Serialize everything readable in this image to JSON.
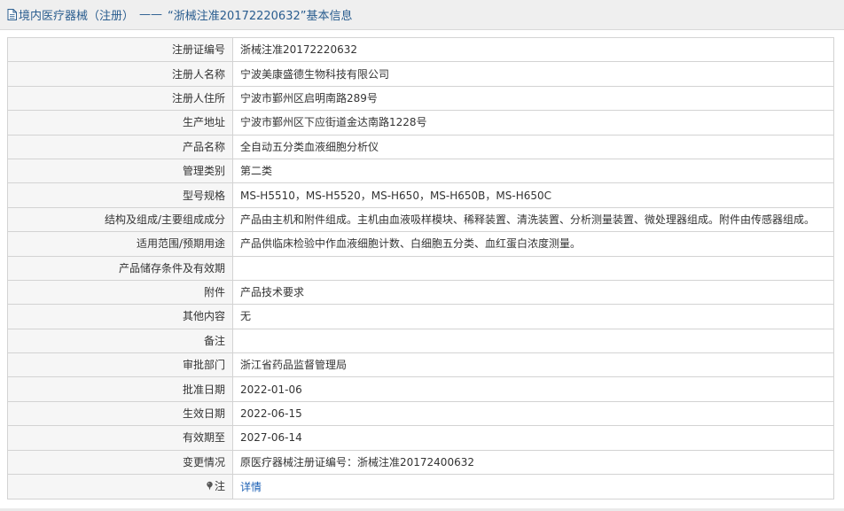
{
  "header": {
    "category": "境内医疗器械（注册）",
    "separator": "——",
    "reg_quote": "“浙械注准20172220632”",
    "suffix": "基本信息"
  },
  "rows": [
    {
      "label": "注册证编号",
      "value": "浙械注准20172220632"
    },
    {
      "label": "注册人名称",
      "value": "宁波美康盛德生物科技有限公司"
    },
    {
      "label": "注册人住所",
      "value": "宁波市鄞州区启明南路289号"
    },
    {
      "label": "生产地址",
      "value": "宁波市鄞州区下应街道金达南路1228号"
    },
    {
      "label": "产品名称",
      "value": "全自动五分类血液细胞分析仪"
    },
    {
      "label": "管理类别",
      "value": "第二类"
    },
    {
      "label": "型号规格",
      "value": "MS-H5510，MS-H5520，MS-H650，MS-H650B，MS-H650C"
    },
    {
      "label": "结构及组成/主要组成成分",
      "value": "产品由主机和附件组成。主机由血液吸样模块、稀释装置、清洗装置、分析测量装置、微处理器组成。附件由传感器组成。"
    },
    {
      "label": "适用范围/预期用途",
      "value": "产品供临床检验中作血液细胞计数、白细胞五分类、血红蛋白浓度测量。"
    },
    {
      "label": "产品储存条件及有效期",
      "value": ""
    },
    {
      "label": "附件",
      "value": "产品技术要求"
    },
    {
      "label": "其他内容",
      "value": "无"
    },
    {
      "label": "备注",
      "value": ""
    },
    {
      "label": "审批部门",
      "value": "浙江省药品监督管理局"
    },
    {
      "label": "批准日期",
      "value": "2022-01-06"
    },
    {
      "label": "生效日期",
      "value": "2022-06-15"
    },
    {
      "label": "有效期至",
      "value": "2027-06-14"
    },
    {
      "label": "变更情况",
      "value": "原医疗器械注册证编号：浙械注准20172400632"
    }
  ],
  "note": {
    "label": "注",
    "icon": "pin-icon",
    "link_text": "详情"
  },
  "colors": {
    "title_text": "#2a5d8f",
    "link": "#1a5fb4",
    "label_bg": "#f6f6f6",
    "border": "#d3d3d3"
  }
}
